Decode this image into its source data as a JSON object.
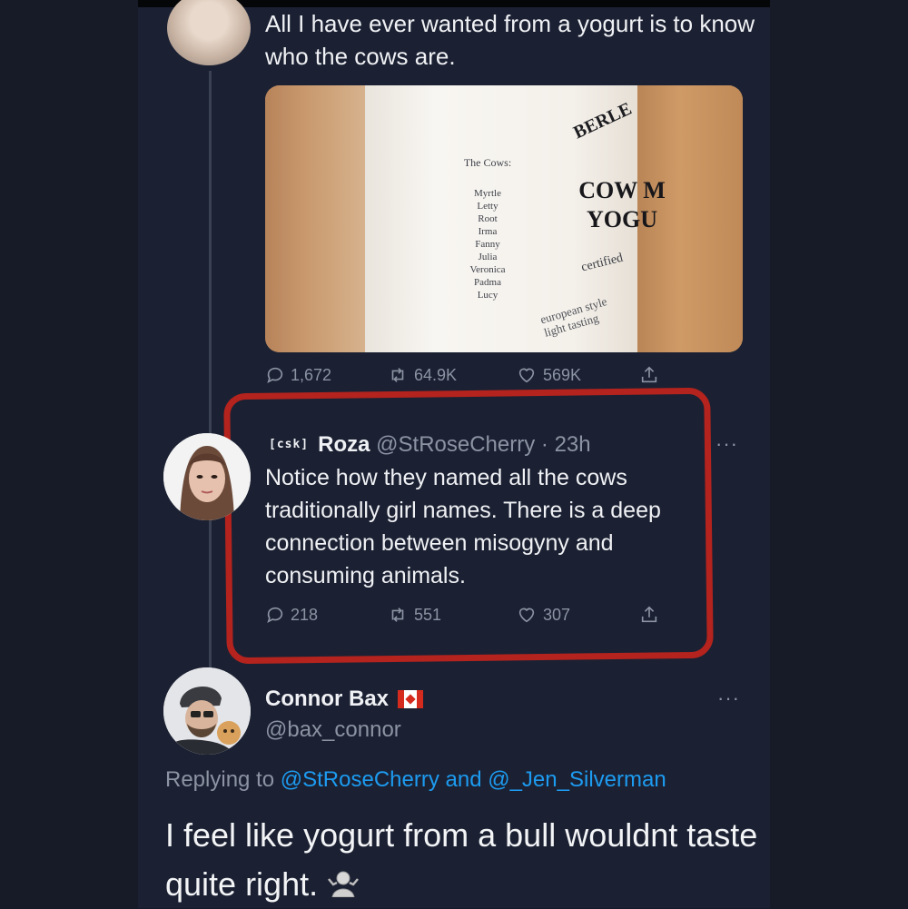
{
  "colors": {
    "background": "#171a27",
    "panel": "#1b2133",
    "muted": "#8c93a2",
    "link": "#1d9bf0",
    "highlight_box": "#b4231d"
  },
  "tweet1": {
    "text": "All I have ever wanted from a yogurt is to know who the cows are.",
    "image": {
      "heading": "The Cows:",
      "cows": [
        "Myrtle",
        "Letty",
        "Root",
        "Irma",
        "Fanny",
        "Julia",
        "Veronica",
        "Padma",
        "Lucy"
      ],
      "brand": "BERLE",
      "product_line1": "COW M",
      "product_line2": "YOGU",
      "certified": "certified",
      "desc_line1": "european style",
      "desc_line2": "light tasting"
    },
    "stats": {
      "replies": "1,672",
      "retweets": "64.9K",
      "likes": "569K"
    }
  },
  "tweet2": {
    "tag": "[csk]",
    "name": "Roza",
    "handle_time": "@StRoseCherry · 23h",
    "text": "Notice how they named all the cows traditionally girl names. There is a deep connection between misogyny and consuming animals.",
    "stats": {
      "replies": "218",
      "retweets": "551",
      "likes": "307"
    },
    "more": "···"
  },
  "tweet3": {
    "name": "Connor Bax",
    "handle": "@bax_connor",
    "reply_prefix": "Replying to",
    "reply_to_1": "@StRoseCherry",
    "reply_and": "and",
    "reply_to_2": "@_Jen_Silverman",
    "text": "I feel like yogurt from a bull wouldnt taste quite right.",
    "more": "···",
    "emoji": "shrug-emoji"
  },
  "icons": [
    "reply-icon",
    "retweet-icon",
    "like-icon",
    "share-icon",
    "canada-flag-icon",
    "more-icon"
  ]
}
